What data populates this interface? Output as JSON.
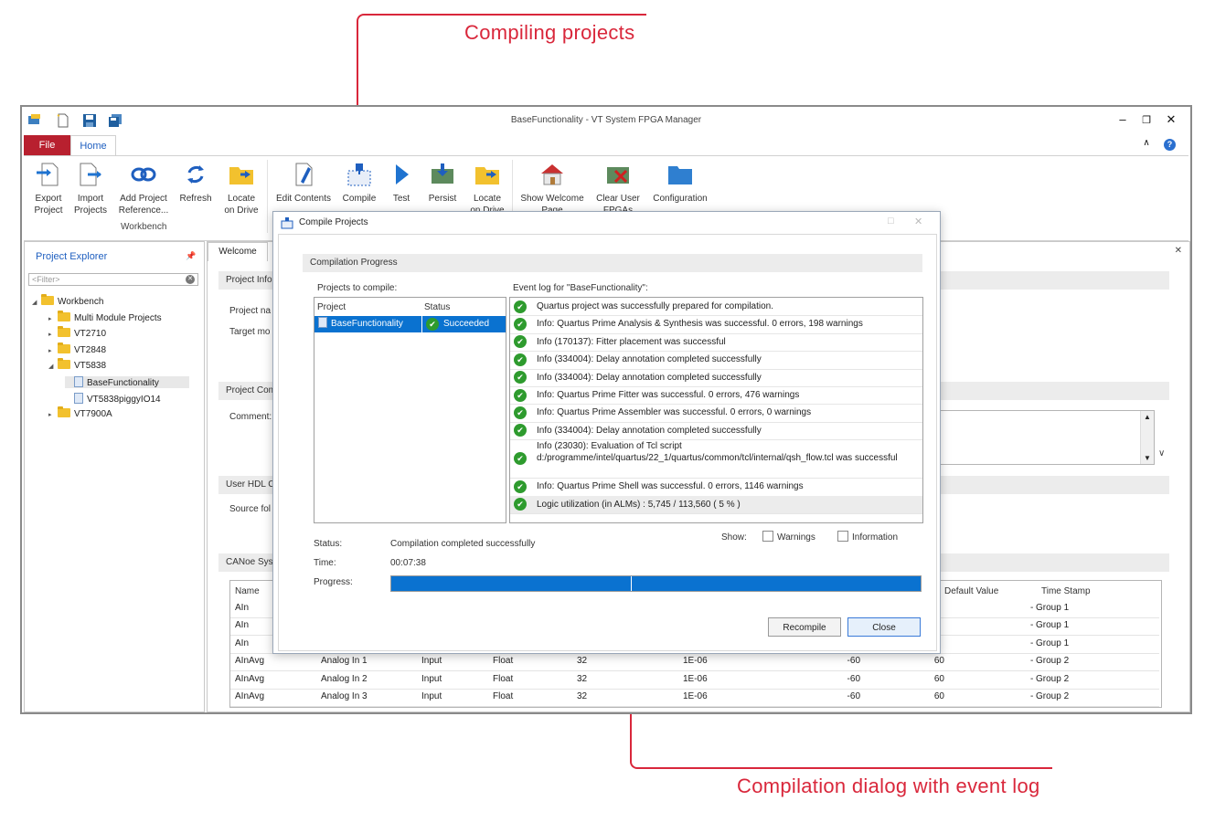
{
  "callouts": {
    "top": "Compiling projects",
    "bottom": "Compilation dialog with event log"
  },
  "colors": {
    "accent_red": "#d9273b",
    "file_tab": "#b8202f",
    "selection": "#0a72d0",
    "ok_green": "#2e9b2e"
  },
  "window": {
    "title": "BaseFunctionality - VT System FPGA Manager",
    "controls": [
      "–",
      "❐",
      "✕"
    ],
    "ribbon_collapse": "∧",
    "help": "?"
  },
  "tabs": {
    "file": "File",
    "home": "Home"
  },
  "ribbon": {
    "export_project": [
      "Export",
      "Project"
    ],
    "import_projects": [
      "Import",
      "Projects"
    ],
    "add_project_ref": [
      "Add Project",
      "Reference..."
    ],
    "refresh": [
      "Refresh",
      ""
    ],
    "locate_drive1": [
      "Locate",
      "on Drive"
    ],
    "workbench_group": "Workbench",
    "edit_contents": [
      "Edit Contents",
      ""
    ],
    "compile": [
      "Compile",
      ""
    ],
    "test": [
      "Test",
      ""
    ],
    "persist": [
      "Persist",
      ""
    ],
    "locate_drive2": [
      "Locate",
      "on Drive"
    ],
    "show_welcome": [
      "Show Welcome",
      "Page"
    ],
    "clear_user": [
      "Clear User",
      "FPGAs"
    ],
    "configuration": [
      "Configuration",
      ""
    ]
  },
  "explorer": {
    "title": "Project Explorer",
    "pin": "📌",
    "filter_placeholder": "<Filter>",
    "items": [
      {
        "label": "Workbench",
        "level": 0,
        "arrow": "◢"
      },
      {
        "label": "Multi Module Projects",
        "level": 1,
        "arrow": "▸"
      },
      {
        "label": "VT2710",
        "level": 1,
        "arrow": "▸"
      },
      {
        "label": "VT2848",
        "level": 1,
        "arrow": "▸"
      },
      {
        "label": "VT5838",
        "level": 1,
        "arrow": "◢"
      },
      {
        "label": "BaseFunctionality",
        "level": 2,
        "arrow": ""
      },
      {
        "label": "VT5838piggyIO14",
        "level": 2,
        "arrow": ""
      },
      {
        "label": "VT7900A",
        "level": 1,
        "arrow": "▸"
      }
    ]
  },
  "main": {
    "tab_welcome": "Welcome",
    "close": "✕",
    "sec_project_info": "Project Info",
    "project_name_lbl": "Project na",
    "target_mo_lbl": "Target mo",
    "sec_project_comment": "Project Com",
    "comment_lbl": "Comment:",
    "sec_user_hdl": "User HDL C",
    "source_fol_lbl": "Source fol",
    "sec_canoe": "CANoe Syst",
    "grid_headers": {
      "name": "Name",
      "default": "Default Value",
      "timestamp": "Time Stamp"
    },
    "grid_rows": [
      {
        "name": "AIn",
        "c2": "",
        "c3": "",
        "c4": "",
        "c5": "",
        "c6": "",
        "c7": "",
        "c8": "",
        "grp": "Group 1"
      },
      {
        "name": "AIn",
        "c2": "",
        "c3": "",
        "c4": "",
        "c5": "",
        "c6": "",
        "c7": "",
        "c8": "",
        "grp": "Group 1"
      },
      {
        "name": "AIn",
        "c2": "",
        "c3": "",
        "c4": "",
        "c5": "",
        "c6": "",
        "c7": "",
        "c8": "",
        "grp": "Group 1"
      },
      {
        "name": "AInAvg",
        "c2": "Analog In 1",
        "c3": "Input",
        "c4": "Float",
        "c5": "32",
        "c6": "1E-06",
        "c7": "-60",
        "c8": "60",
        "grp": "Group 2"
      },
      {
        "name": "AInAvg",
        "c2": "Analog In 2",
        "c3": "Input",
        "c4": "Float",
        "c5": "32",
        "c6": "1E-06",
        "c7": "-60",
        "c8": "60",
        "grp": "Group 2"
      },
      {
        "name": "AInAvg",
        "c2": "Analog In 3",
        "c3": "Input",
        "c4": "Float",
        "c5": "32",
        "c6": "1E-06",
        "c7": "-60",
        "c8": "60",
        "grp": "Group 2"
      }
    ]
  },
  "dialog": {
    "title": "Compile Projects",
    "compilation_progress": "Compilation Progress",
    "projects_to_compile": "Projects to compile:",
    "col_project": "Project",
    "col_status": "Status",
    "project_name": "BaseFunctionality",
    "project_status": "Succeeded",
    "event_log_title": "Event log for \"BaseFunctionality\":",
    "log": [
      "Quartus project was successfully prepared for compilation.",
      "Info: Quartus Prime Analysis & Synthesis was successful. 0 errors, 198 warnings",
      "Info (170137): Fitter placement was successful",
      "Info (334004): Delay annotation completed successfully",
      "Info (334004): Delay annotation completed successfully",
      "Info: Quartus Prime Fitter was successful. 0 errors, 476 warnings",
      "Info: Quartus Prime Assembler was successful. 0 errors, 0 warnings",
      "Info (334004): Delay annotation completed successfully",
      "Info (23030): Evaluation of Tcl script d:/programme/intel/quartus/22_1/quartus/common/tcl/internal/qsh_flow.tcl was successful",
      "Info: Quartus Prime Shell was successful. 0 errors, 1146 warnings",
      "Logic utilization (in ALMs) : 5,745 / 113,560 ( 5 % )"
    ],
    "status_lbl": "Status:",
    "status_val": "Compilation completed successfully",
    "time_lbl": "Time:",
    "time_val": "00:07:38",
    "progress_lbl": "Progress:",
    "progress": 1.0,
    "show_lbl": "Show:",
    "warnings_lbl": "Warnings",
    "information_lbl": "Information",
    "recompile": "Recompile",
    "close": "Close"
  }
}
